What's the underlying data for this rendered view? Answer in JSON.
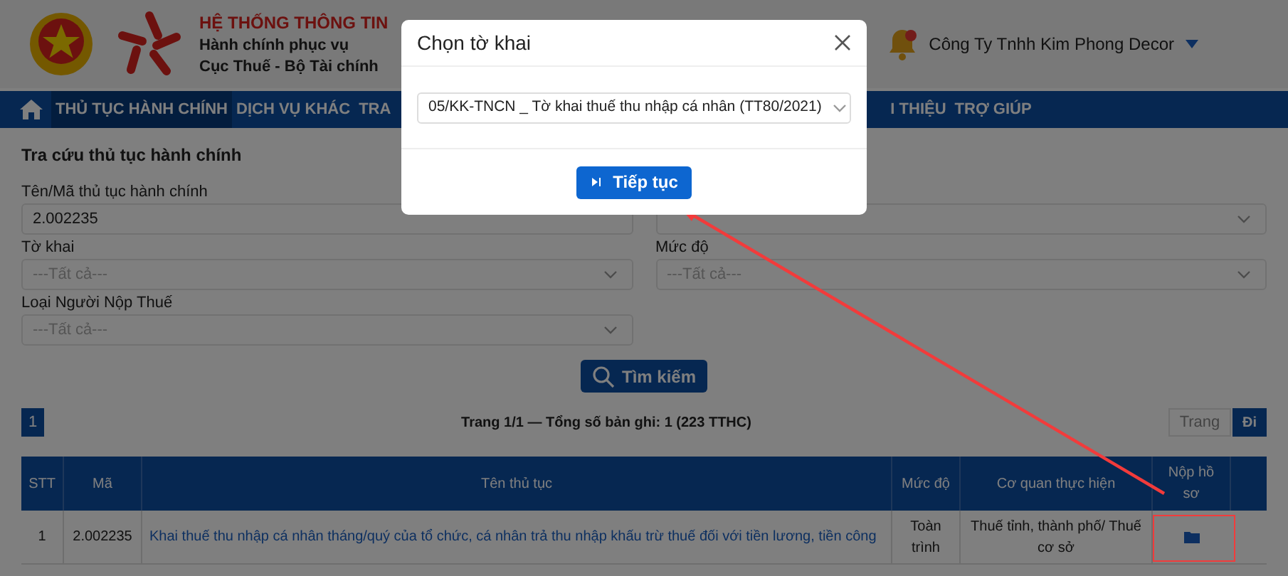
{
  "header": {
    "title": "HỆ THỐNG THÔNG TIN",
    "subtitle_lines": [
      "Hành chính phục vụ",
      "Cục Thuế - Bộ Tài chính"
    ],
    "user": "Công Ty Tnhh Kim Phong Decor"
  },
  "nav": {
    "items": [
      {
        "label": "THỦ TỤC HÀNH CHÍNH",
        "selected": true
      },
      {
        "label": "DỊCH VỤ KHÁC",
        "selected": false
      },
      {
        "label": "TRA",
        "selected": false
      },
      {
        "label": "I THIỆU",
        "selected": false
      },
      {
        "label": "TRỢ GIÚP",
        "selected": false
      }
    ]
  },
  "search": {
    "heading": "Tra cứu thủ tục hành chính",
    "left_fields": [
      {
        "kind": "input",
        "label": "Tên/Mã thủ tục hành chính",
        "value": "2.002235"
      },
      {
        "kind": "select",
        "label": "Tờ khai",
        "placeholder": "---Tất cả---"
      },
      {
        "kind": "select",
        "label": "Loại Người Nộp Thuế",
        "placeholder": "---Tất cả---"
      }
    ],
    "right_fields": [
      {
        "kind": "select"
      },
      {
        "kind": "select",
        "label": "Mức độ",
        "placeholder": "---Tất cả---"
      }
    ],
    "button": "Tìm kiếm"
  },
  "pagination": {
    "pages": [
      {
        "label": "1",
        "selected": true
      }
    ],
    "summary": "Trang 1/1 — Tổng số bản ghi: 1 (223 TTHC)",
    "page_input": {
      "placeholder": "Trang"
    },
    "go": "Đi"
  },
  "table": {
    "columns": [
      "STT",
      "Mã",
      "Tên thủ tục",
      "Mức độ",
      "Cơ quan thực hiện",
      "Nộp hồ sơ"
    ],
    "rows": [
      {
        "stt": "1",
        "code": "2.002235",
        "name": "Khai thuế thu nhập cá nhân tháng/quý của tổ chức, cá nhân trả thu nhập khấu trừ thuế đối với tiền lương, tiền công",
        "level": "Toàn trình",
        "agency": "Thuế tỉnh, thành phố/ Thuế cơ sở"
      }
    ]
  },
  "modal": {
    "title": "Chọn tờ khai",
    "select_value": "05/KK-TNCN _ Tờ khai thuế thu nhập cá nhân (TT80/2021)",
    "button": "Tiếp tục"
  }
}
